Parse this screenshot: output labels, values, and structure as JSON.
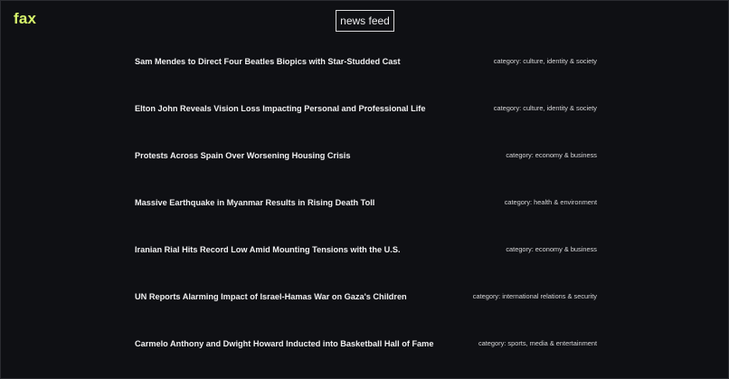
{
  "header": {
    "logo_text": "fax",
    "logo_color": "#d7f56b",
    "nav_button_label": "news feed"
  },
  "feed": {
    "items": [
      {
        "headline": "Sam Mendes to Direct Four Beatles Biopics with Star-Studded Cast",
        "category": "category: culture, identity & society"
      },
      {
        "headline": "Elton John Reveals Vision Loss Impacting Personal and Professional Life",
        "category": "category: culture, identity & society"
      },
      {
        "headline": "Protests Across Spain Over Worsening Housing Crisis",
        "category": "category: economy & business"
      },
      {
        "headline": "Massive Earthquake in Myanmar Results in Rising Death Toll",
        "category": "category: health & environment"
      },
      {
        "headline": "Iranian Rial Hits Record Low Amid Mounting Tensions with the U.S.",
        "category": "category: economy & business"
      },
      {
        "headline": "UN Reports Alarming Impact of Israel-Hamas War on Gaza's Children",
        "category": "category: international relations & security"
      },
      {
        "headline": "Carmelo Anthony and Dwight Howard Inducted into Basketball Hall of Fame",
        "category": "category: sports, media & entertainment"
      }
    ]
  }
}
